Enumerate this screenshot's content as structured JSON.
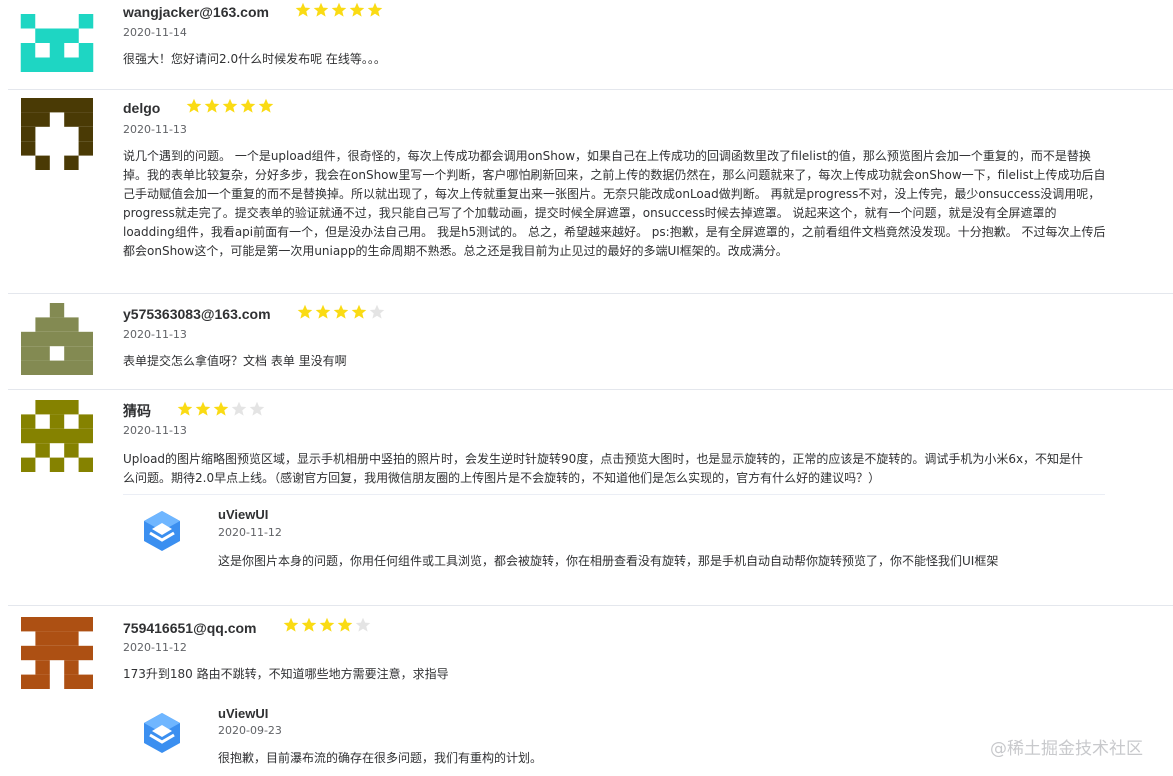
{
  "colors": {
    "star_on": "#fadb14",
    "star_off": "#e4e4e4",
    "avatar1": "#1ed6c3",
    "avatar2": "#4a3a05",
    "avatar3": "#838a52",
    "avatar4": "#858200",
    "avatar5": "#ad5013"
  },
  "reviews": [
    {
      "name": "wangjacker@163.com",
      "rating": 5,
      "date": "2020-11-14",
      "content": "很强大！您好请问2.0什么时候发布呢 在线等。。。"
    },
    {
      "name": "delgo",
      "rating": 5,
      "date": "2020-11-13",
      "content": "说几个遇到的问题。 一个是upload组件，很奇怪的，每次上传成功都会调用onShow，如果自己在上传成功的回调函数里改了filelist的值，那么预览图片会加一个重复的，而不是替换掉。我的表单比较复杂，分好多步，我会在onShow里写一个判断，客户哪怕刷新回来，之前上传的数据仍然在，那么问题就来了，每次上传成功就会onShow一下，filelist上传成功后自己手动赋值会加一个重复的而不是替换掉。所以就出现了，每次上传就重复出来一张图片。无奈只能改成onLoad做判断。 再就是progress不对，没上传完，最少onsuccess没调用呢，progress就走完了。提交表单的验证就通不过，我只能自己写了个加载动画，提交时候全屏遮罩，onsuccess时候去掉遮罩。 说起来这个，就有一个问题，就是没有全屏遮罩的loadding组件，我看api前面有一个，但是没办法自己用。 我是h5测试的。 总之，希望越来越好。 ps:抱歉，是有全屏遮罩的，之前看组件文档竟然没发现。十分抱歉。 不过每次上传后都会onShow这个，可能是第一次用uniapp的生命周期不熟悉。总之还是我目前为止见过的最好的多端UI框架的。改成满分。"
    },
    {
      "name": "y575363083@163.com",
      "rating": 4,
      "date": "2020-11-13",
      "content": "表单提交怎么拿值呀？文档 表单 里没有啊"
    },
    {
      "name": "猜码",
      "rating": 3,
      "date": "2020-11-13",
      "content": "Upload的图片缩略图预览区域，显示手机相册中竖拍的照片时，会发生逆时针旋转90度，点击预览大图时，也是显示旋转的，正常的应该是不旋转的。调试手机为小米6x，不知是什么问题。期待2.0早点上线。（感谢官方回复，我用微信朋友圈的上传图片是不会旋转的，不知道他们是怎么实现的，官方有什么好的建议吗？）",
      "reply": {
        "name": "uViewUI",
        "date": "2020-11-12",
        "content": "这是你图片本身的问题，你用任何组件或工具浏览，都会被旋转，你在相册查看没有旋转，那是手机自动自动帮你旋转预览了，你不能怪我们UI框架"
      }
    },
    {
      "name": "759416651@qq.com",
      "rating": 4,
      "date": "2020-11-12",
      "content": "173升到180 路由不跳转，不知道哪些地方需要注意，求指导",
      "reply": {
        "name": "uViewUI",
        "date": "2020-09-23",
        "content": "很抱歉，目前瀑布流的确存在很多问题，我们有重构的计划。"
      }
    }
  ],
  "watermark": "@稀土掘金技术社区"
}
